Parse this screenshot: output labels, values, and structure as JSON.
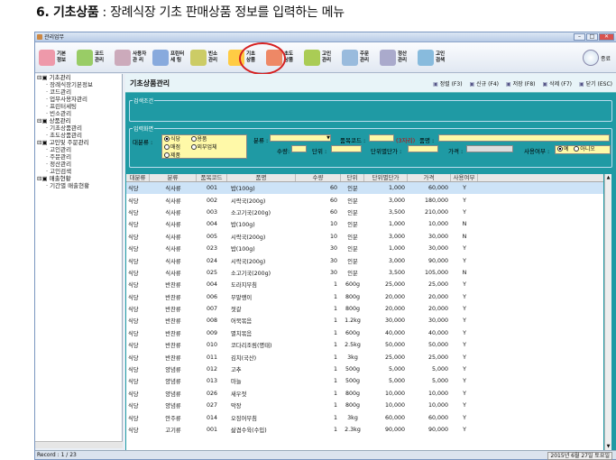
{
  "caption": {
    "num": "6. 기초상품",
    "rest": " : 장례식장 기초 판매상품 정보를 입력하는 메뉴"
  },
  "window": {
    "title": "관리업무"
  },
  "toolbar": [
    {
      "label": "기본\n정보",
      "color": "#e9a"
    },
    {
      "label": "코드\n관리",
      "color": "#9c6"
    },
    {
      "label": "사용자\n관 리",
      "color": "#cab"
    },
    {
      "label": "프린터\n세 팅",
      "color": "#8ad"
    },
    {
      "label": "빈소\n관리",
      "color": "#cc6"
    },
    {
      "label": "기초\n상품",
      "color": "#fc4"
    },
    {
      "label": "초도\n상품",
      "color": "#e86"
    },
    {
      "label": "고인\n관리",
      "color": "#ac5"
    },
    {
      "label": "주문\n관리",
      "color": "#9bd"
    },
    {
      "label": "정산\n관리",
      "color": "#aac"
    },
    {
      "label": "고인\n검색",
      "color": "#8bd"
    }
  ],
  "close_label": "종료",
  "tree": [
    {
      "label": "기초관리",
      "level": 0
    },
    {
      "label": "장례식장기본정보",
      "level": 1
    },
    {
      "label": "코드관리",
      "level": 1
    },
    {
      "label": "업무사용자관리",
      "level": 1
    },
    {
      "label": "프린터세팅",
      "level": 1
    },
    {
      "label": "빈소관리",
      "level": 1
    },
    {
      "label": "상품관리",
      "level": 0
    },
    {
      "label": "기초상품관리",
      "level": 1
    },
    {
      "label": "초도상품관리",
      "level": 1
    },
    {
      "label": "고인및 주문관리",
      "level": 0
    },
    {
      "label": "고인관리",
      "level": 1
    },
    {
      "label": "주문관리",
      "level": 1
    },
    {
      "label": "정산관리",
      "level": 1
    },
    {
      "label": "고인검색",
      "level": 1
    },
    {
      "label": "매출현황",
      "level": 0
    },
    {
      "label": "기간별 매출현황",
      "level": 1
    }
  ],
  "header": {
    "title": "기초상품관리",
    "buttons": [
      "정렬 (F3)",
      "신규 (F4)",
      "저장 (F8)",
      "삭제 (F7)",
      "닫기 (ESC)"
    ]
  },
  "search_group": "검색조건",
  "input_group": "입력화면",
  "form": {
    "big_cat_label": "대분류 :",
    "radios": [
      "식당",
      "용품",
      "매점",
      "외부업체",
      "제품"
    ],
    "cat_label": "분류 :",
    "code_label": "품목코드 :",
    "code_hint": "(3자리)",
    "name_label": "품명 :",
    "qty_label": "수량:",
    "unit_label": "단위 :",
    "unitprice_label": "단위별단가 :",
    "price_label": "가격 :",
    "use_label": "사용여부 :",
    "use_yes": "예",
    "use_no": "아니오"
  },
  "columns": [
    "대분류",
    "분류",
    "품목코드",
    "품명",
    "수량",
    "단위",
    "단위별단가",
    "가격",
    "사용여부"
  ],
  "rows": [
    [
      "식당",
      "식사류",
      "001",
      "밥(100g)",
      "60",
      "인분",
      "1,000",
      "60,000",
      "Y"
    ],
    [
      "식당",
      "식사류",
      "002",
      "시락국(200g)",
      "60",
      "인분",
      "3,000",
      "180,000",
      "Y"
    ],
    [
      "식당",
      "식사류",
      "003",
      "소고기국(200g)",
      "60",
      "인분",
      "3,500",
      "210,000",
      "Y"
    ],
    [
      "식당",
      "식사류",
      "004",
      "밥(100g)",
      "10",
      "인분",
      "1,000",
      "10,000",
      "N"
    ],
    [
      "식당",
      "식사류",
      "005",
      "시락국(200g)",
      "10",
      "인분",
      "3,000",
      "30,000",
      "N"
    ],
    [
      "식당",
      "식사류",
      "023",
      "밥(100g)",
      "30",
      "인분",
      "1,000",
      "30,000",
      "Y"
    ],
    [
      "식당",
      "식사류",
      "024",
      "시락국(200g)",
      "30",
      "인분",
      "3,000",
      "90,000",
      "Y"
    ],
    [
      "식당",
      "식사류",
      "025",
      "소고기국(200g)",
      "30",
      "인분",
      "3,500",
      "105,000",
      "N"
    ],
    [
      "식당",
      "반찬류",
      "004",
      "도라지무침",
      "1",
      "600g",
      "25,000",
      "25,000",
      "Y"
    ],
    [
      "식당",
      "반찬류",
      "006",
      "무말랭이",
      "1",
      "800g",
      "20,000",
      "20,000",
      "Y"
    ],
    [
      "식당",
      "반찬류",
      "007",
      "젓갈",
      "1",
      "800g",
      "20,000",
      "20,000",
      "Y"
    ],
    [
      "식당",
      "반찬류",
      "008",
      "어묵볶음",
      "1",
      "1.2kg",
      "30,000",
      "30,000",
      "Y"
    ],
    [
      "식당",
      "반찬류",
      "009",
      "멸치볶음",
      "1",
      "600g",
      "40,000",
      "40,000",
      "Y"
    ],
    [
      "식당",
      "반찬류",
      "010",
      "코다리조림(명태)",
      "1",
      "2.5kg",
      "50,000",
      "50,000",
      "Y"
    ],
    [
      "식당",
      "반찬류",
      "011",
      "김치(국산)",
      "1",
      "3kg",
      "25,000",
      "25,000",
      "Y"
    ],
    [
      "식당",
      "양념류",
      "012",
      "고추",
      "1",
      "500g",
      "5,000",
      "5,000",
      "Y"
    ],
    [
      "식당",
      "양념류",
      "013",
      "마늘",
      "1",
      "500g",
      "5,000",
      "5,000",
      "Y"
    ],
    [
      "식당",
      "양념류",
      "026",
      "새우젓",
      "1",
      "800g",
      "10,000",
      "10,000",
      "Y"
    ],
    [
      "식당",
      "양념류",
      "027",
      "막장",
      "1",
      "800g",
      "10,000",
      "10,000",
      "Y"
    ],
    [
      "식당",
      "안주류",
      "014",
      "오징어무침",
      "1",
      "3kg",
      "60,000",
      "60,000",
      "Y"
    ],
    [
      "식당",
      "고기류",
      "001",
      "삶겹수육(수입)",
      "1",
      "2.3kg",
      "90,000",
      "90,000",
      "Y"
    ]
  ],
  "status": {
    "record": "Record : 1 / 23",
    "date": "2015년 6월 27일 토요일"
  }
}
